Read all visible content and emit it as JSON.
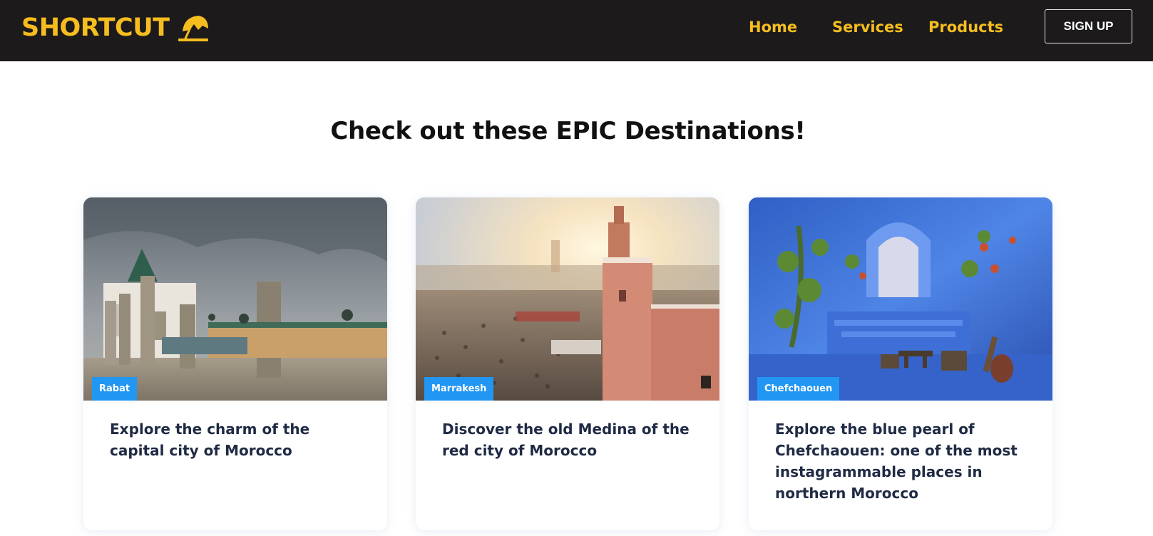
{
  "navbar": {
    "brand": "SHORTCUT",
    "brand_icon": "beach-umbrella-icon",
    "links": [
      "Home",
      "Services",
      "Products"
    ],
    "signup_label": "SIGN UP",
    "colors": {
      "background": "#1c1a1a",
      "accent": "#f5bd1f"
    }
  },
  "main": {
    "title": "Check out these EPIC Destinations!"
  },
  "cards": [
    {
      "badge": "Rabat",
      "image": "rabat-hassan-tower-photo",
      "text": "Explore the charm of the capital city of Morocco"
    },
    {
      "badge": "Marrakesh",
      "image": "marrakesh-jemaa-el-fnaa-photo",
      "text": "Discover the old Medina of the red city of Morocco"
    },
    {
      "badge": "Chefchaouen",
      "image": "chefchaouen-blue-street-photo",
      "text": "Explore the blue pearl of Chefchaouen: one of the most instagrammable places in northern Morocco"
    }
  ],
  "colors": {
    "badge": "#2196f3",
    "card_text": "#1f2a44"
  }
}
